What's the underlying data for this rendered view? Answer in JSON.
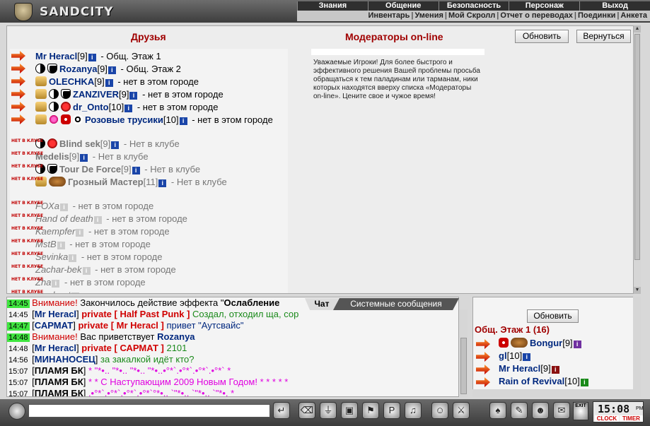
{
  "top": {
    "brand": "SANDCITY",
    "menu": [
      "Знания",
      "Общение",
      "Безопасность",
      "Персонаж",
      "Выход"
    ],
    "submenu": [
      "Инвентарь",
      "Умения",
      "Мой Скролл",
      "Отчет о переводах",
      "Поединки",
      "Анкета"
    ]
  },
  "main": {
    "friends_title": "Друзья",
    "mods_title": "Модераторы on-line",
    "refresh_label": "Обновить",
    "back_label": "Вернуться",
    "away_badge": "НЕТ В КЛУБЕ",
    "mods_text": "Уважаемые Игроки! Для более быстрого и эффективного решения Вашей проблемы просьба обращаться к тем паладинам или тарманам, ники которых находятся вверху списка «Модераторы on-line». Цените свое и чужое время!",
    "friends": [
      {
        "name": "Mr Heracl",
        "level": "[9]",
        "location": " - Общ. Этаж 1",
        "state": "online"
      },
      {
        "name": "Rozanya",
        "level": "[9]",
        "location": " - Общ. Этаж 2",
        "state": "online"
      },
      {
        "name": "OLECHKA",
        "level": "[9]",
        "location": " - нет в этом городе",
        "state": "online"
      },
      {
        "name": "ZANZIVER",
        "level": "[9]",
        "location": " - нет в этом городе",
        "state": "online"
      },
      {
        "name": "dr_Onto",
        "level": "[10]",
        "location": " - нет в этом городе",
        "state": "online"
      },
      {
        "name": "Розовые трусики",
        "level": "[10]",
        "location": " - нет в этом городе",
        "state": "online"
      },
      {
        "name": "Blind sek",
        "level": "[9]",
        "location": " - Нет в клубе",
        "state": "away"
      },
      {
        "name": "Medelis",
        "level": "[9]",
        "location": " - Нет в клубе",
        "state": "away"
      },
      {
        "name": "Tour De Force",
        "level": "[9]",
        "location": " - Нет в клубе",
        "state": "away"
      },
      {
        "name": "Грозный Мастер",
        "level": "[11]",
        "location": " - Нет в клубе",
        "state": "away"
      },
      {
        "name": "FOXa",
        "level": "",
        "location": " - нет в этом городе",
        "state": "offline"
      },
      {
        "name": "Hand of death",
        "level": "",
        "location": " - нет в этом городе",
        "state": "offline"
      },
      {
        "name": "Kaempfer",
        "level": "",
        "location": " - нет в этом городе",
        "state": "offline"
      },
      {
        "name": "MstB",
        "level": "",
        "location": " - нет в этом городе",
        "state": "offline"
      },
      {
        "name": "Sevinka",
        "level": "",
        "location": " - нет в этом городе",
        "state": "offline"
      },
      {
        "name": "Zachar-bek",
        "level": "",
        "location": " - нет в этом городе",
        "state": "offline"
      },
      {
        "name": "Zha",
        "level": "",
        "location": " - нет в этом городе",
        "state": "offline"
      },
      {
        "name": "zamboat",
        "level": "",
        "location": " - нет в этом городе",
        "state": "offline"
      }
    ]
  },
  "chat": {
    "tab_chat": "Чат",
    "tab_system": "Системные сообщения",
    "lines": [
      {
        "time": "14:45",
        "hl": true,
        "parts": [
          {
            "t": "Внимание! ",
            "c": "warn"
          },
          {
            "t": "Закончилось действие эффекта \"",
            "c": "msg"
          },
          {
            "t": "Ослабление",
            "c": "bold"
          }
        ]
      },
      {
        "time": "14:45",
        "hl": false,
        "parts": [
          {
            "t": "[",
            "c": "msg"
          },
          {
            "t": "Mr Heracl",
            "c": "who"
          },
          {
            "t": "] ",
            "c": "msg"
          },
          {
            "t": "private [ Half Past Punk ] ",
            "c": "pv"
          },
          {
            "t": "Создал, отходил ща, сор",
            "c": "green"
          }
        ]
      },
      {
        "time": "14:47",
        "hl": true,
        "parts": [
          {
            "t": "[",
            "c": "msg"
          },
          {
            "t": "САРМАТ",
            "c": "who"
          },
          {
            "t": "] ",
            "c": "msg"
          },
          {
            "t": "private [ Mr Heracl ] ",
            "c": "pv"
          },
          {
            "t": "привет \"Аутсвайс\"",
            "c": "navy"
          }
        ]
      },
      {
        "time": "14:48",
        "hl": true,
        "parts": [
          {
            "t": "Внимание! ",
            "c": "warn"
          },
          {
            "t": "Вас приветствует ",
            "c": "msg"
          },
          {
            "t": "Rozanya",
            "c": "who"
          }
        ]
      },
      {
        "time": "14:48",
        "hl": false,
        "parts": [
          {
            "t": "[",
            "c": "msg"
          },
          {
            "t": "Mr Heracl",
            "c": "who"
          },
          {
            "t": "] ",
            "c": "msg"
          },
          {
            "t": "private [ САРМАТ ] ",
            "c": "pv"
          },
          {
            "t": "2101",
            "c": "green"
          }
        ]
      },
      {
        "time": "14:56",
        "hl": false,
        "parts": [
          {
            "t": "[",
            "c": "msg"
          },
          {
            "t": "МИНАНОСЕЦ",
            "c": "who"
          },
          {
            "t": "] ",
            "c": "msg"
          },
          {
            "t": "за закалкой идёт кто?",
            "c": "green"
          }
        ]
      },
      {
        "time": "15:07",
        "hl": false,
        "parts": [
          {
            "t": "[",
            "c": "msg"
          },
          {
            "t": "ПЛАМЯ БК",
            "c": "whobr"
          },
          {
            "t": "] ",
            "c": "msg"
          },
          {
            "t": "* \"*•.. \"*•.. \"*•.. \"*•..•°*`.•°*`.•°*`.•°*` *",
            "c": "magenta"
          }
        ]
      },
      {
        "time": "15:07",
        "hl": false,
        "parts": [
          {
            "t": "[",
            "c": "msg"
          },
          {
            "t": "ПЛАМЯ БК",
            "c": "whobr"
          },
          {
            "t": "] ",
            "c": "msg"
          },
          {
            "t": "* * С Наступающим 2009 Новым Годом! * * * * *",
            "c": "magenta"
          }
        ]
      },
      {
        "time": "15:07",
        "hl": false,
        "parts": [
          {
            "t": "[",
            "c": "msg"
          },
          {
            "t": "ПЛАМЯ БК",
            "c": "whobr"
          },
          {
            "t": "] ",
            "c": "msg"
          },
          {
            "t": ".•°*`.•°*`.•°*`.•°*`°*•.. `\"*•.. `\"*•.. `\"*•. *",
            "c": "magenta"
          }
        ]
      }
    ]
  },
  "online": {
    "refresh_label": "Обновить",
    "location_title": "Общ. Этаж 1 (16)",
    "users": [
      {
        "name": "Bongur",
        "level": "[9]",
        "info": "purple"
      },
      {
        "name": "gl",
        "level": "[10]",
        "info": "blue"
      },
      {
        "name": "Mr Heracl",
        "level": "[9]",
        "info": "red"
      },
      {
        "name": "Rain of Revival",
        "level": "[10]",
        "info": "green"
      }
    ]
  },
  "toolbar": {
    "input_value": "",
    "exit_label": "EXIT",
    "clock": "15:08",
    "clock_suffix": "PM",
    "clock_label": "CLOCK",
    "timer_label": "TIMER"
  },
  "colors": {
    "accent": "#a00000",
    "name": "#00287f",
    "highlight": "#3fe63f"
  }
}
